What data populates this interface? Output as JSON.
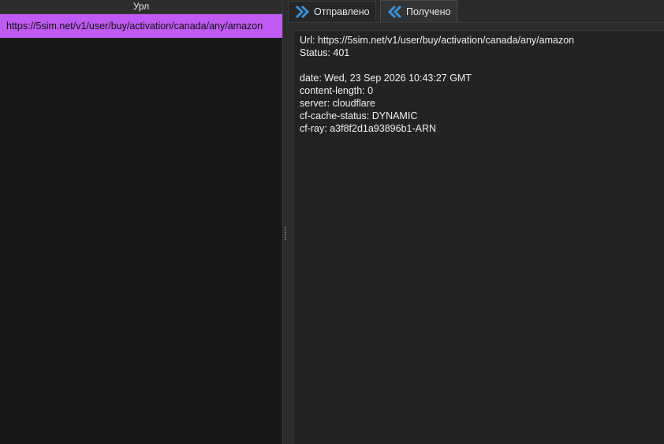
{
  "left": {
    "header": "Урл",
    "rows": [
      {
        "url": "https://5sim.net/v1/user/buy/activation/canada/any/amazon"
      }
    ]
  },
  "tabs": {
    "sent_label": "Отправлено",
    "received_label": "Получено"
  },
  "response": {
    "url_line": "Url: https://5sim.net/v1/user/buy/activation/canada/any/amazon",
    "status_line": "Status: 401",
    "headers": [
      "date: Wed, 23 Sep 2026 10:43:27 GMT",
      "content-length: 0",
      "server: cloudflare",
      "cf-cache-status: DYNAMIC",
      "cf-ray: a3f8f2d1a93896b1-ARN"
    ]
  },
  "colors": {
    "selection": "#bf5af2",
    "icon_blue": "#3a8fd6"
  }
}
